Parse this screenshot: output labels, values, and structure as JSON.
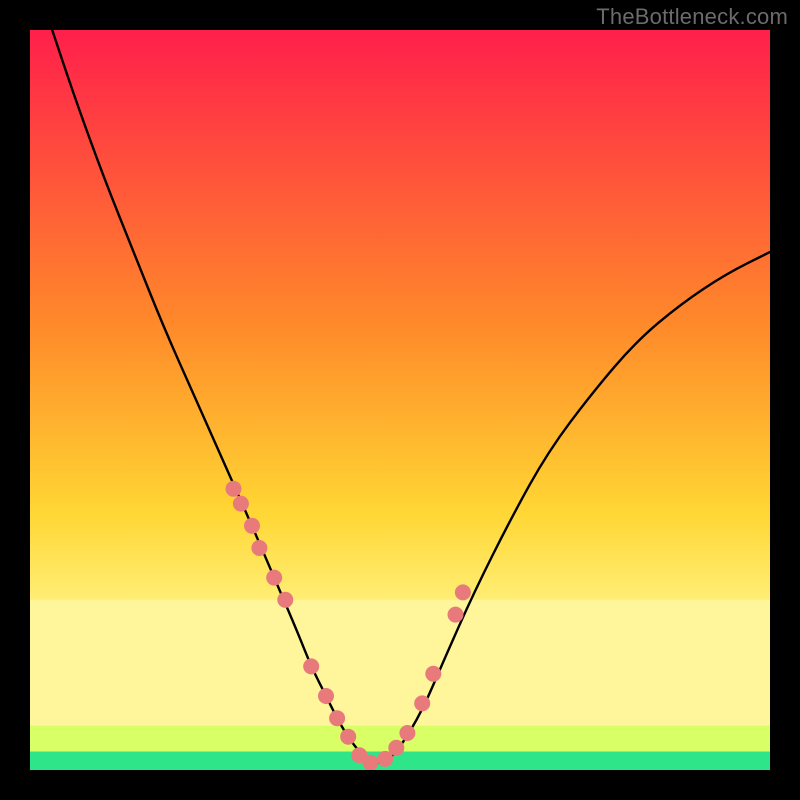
{
  "watermark": "TheBottleneck.com",
  "chart_data": {
    "type": "line",
    "title": "",
    "xlabel": "",
    "ylabel": "",
    "xlim": [
      0,
      100
    ],
    "ylim": [
      0,
      100
    ],
    "grid": false,
    "series": [
      {
        "name": "bottleneck-curve",
        "x": [
          3,
          6,
          10,
          14,
          18,
          22,
          26,
          30,
          33,
          36,
          38,
          40,
          42,
          44,
          46,
          48,
          50,
          53,
          56,
          60,
          65,
          70,
          76,
          82,
          88,
          94,
          100
        ],
        "y": [
          100,
          91,
          80,
          70,
          60,
          51,
          42,
          33,
          26,
          19,
          14,
          10,
          6,
          3,
          1,
          1,
          3,
          8,
          15,
          24,
          34,
          43,
          51,
          58,
          63,
          67,
          70
        ]
      }
    ],
    "markers": {
      "name": "highlight-dots",
      "color": "#e87a7c",
      "x": [
        27.5,
        28.5,
        30,
        31,
        33,
        34.5,
        38,
        40,
        41.5,
        43,
        44.5,
        46,
        48,
        49.5,
        51,
        53,
        54.5,
        57.5,
        58.5
      ],
      "y": [
        38,
        36,
        33,
        30,
        26,
        23,
        14,
        10,
        7,
        4.5,
        2,
        1,
        1.5,
        3,
        5,
        9,
        13,
        21,
        24
      ]
    },
    "bands": [
      {
        "name": "green-band",
        "y0": 0,
        "y1": 2.5,
        "color": "#2fe58a"
      },
      {
        "name": "lime-band",
        "y0": 2.5,
        "y1": 6,
        "color": "#d9ff66"
      },
      {
        "name": "cream-band",
        "y0": 6,
        "y1": 23,
        "color": "#fff59b"
      }
    ],
    "gradient_stops": [
      {
        "offset": 0,
        "color": "#ff1f4b"
      },
      {
        "offset": 40,
        "color": "#ff8a2a"
      },
      {
        "offset": 65,
        "color": "#ffd633"
      },
      {
        "offset": 78,
        "color": "#fff07a"
      },
      {
        "offset": 100,
        "color": "#fff9a8"
      }
    ]
  }
}
